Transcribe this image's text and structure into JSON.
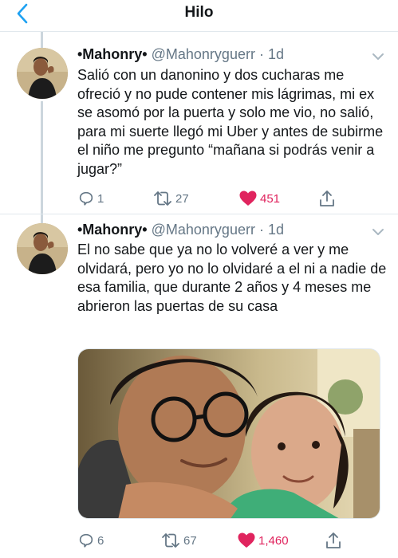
{
  "nav": {
    "title": "Hilo",
    "back_icon": "chevron-left-icon",
    "accent": "#1da1f2"
  },
  "tweets": [
    {
      "name": "•Mahonry•",
      "handle": "@Mahonryguerr",
      "time": "· 1d",
      "text": "Salió con un danonino y dos cucharas me ofreció y no pude contener mis lágrimas, mi ex se asomó por la puerta y solo me vio, no salió, para mi suerte llegó mi Uber y antes de subirme el niño me pregunto “mañana si podrás venir a jugar?”",
      "replies": "1",
      "retweets": "27",
      "likes": "451",
      "liked": true
    },
    {
      "name": "•Mahonry•",
      "handle": "@Mahonryguerr",
      "time": "· 1d",
      "text": "El no sabe que ya no lo volveré a ver y me olvidará, pero yo no lo olvidaré a el ni a nadie de esa familia, que durante 2 años y 4 meses me abrieron las puertas de su casa",
      "replies": "6",
      "retweets": "67",
      "likes": "1,460",
      "liked": true,
      "has_photo": true
    }
  ],
  "colors": {
    "like": "#e0245e",
    "muted": "#657786",
    "text": "#14171a",
    "border": "#e1e8ed"
  }
}
